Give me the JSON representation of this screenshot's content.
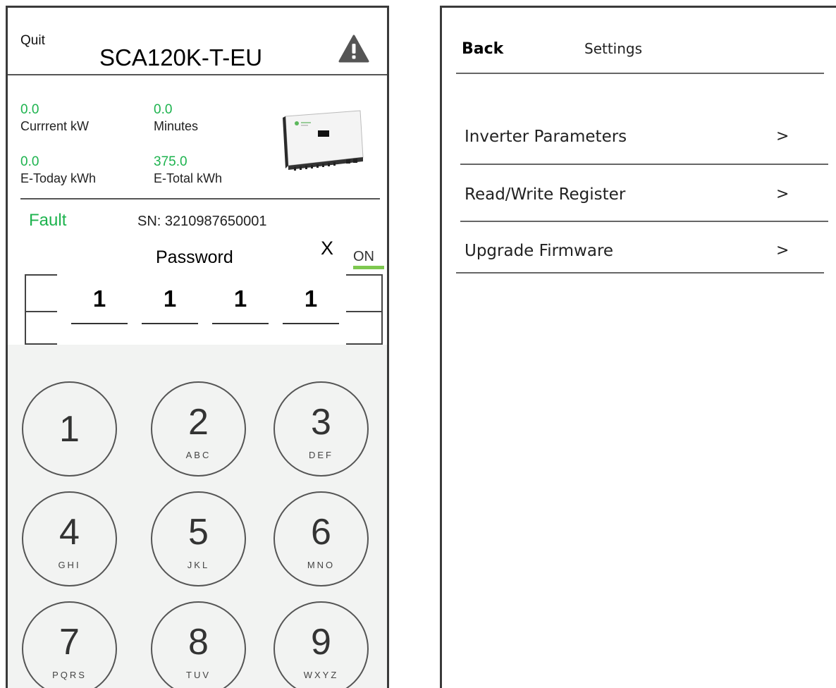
{
  "left": {
    "quit_label": "Quit",
    "device_title": "SCA120K-T-EU",
    "stats": [
      {
        "value": "0.0",
        "label": "Currrent kW"
      },
      {
        "value": "0.0",
        "label": "Minutes"
      },
      {
        "value": "0.0",
        "label": "E-Today kWh"
      },
      {
        "value": "375.0",
        "label": "E-Total kWh"
      }
    ],
    "status_text": "Fault",
    "serial_text": "SN:  3210987650001",
    "tab_edge_text": "ON",
    "password_dialog": {
      "title": "Password",
      "close_label": "X",
      "digits": [
        "1",
        "1",
        "1",
        "1"
      ]
    },
    "keypad": [
      {
        "num": "1",
        "letters": ""
      },
      {
        "num": "2",
        "letters": "ABC"
      },
      {
        "num": "3",
        "letters": "DEF"
      },
      {
        "num": "4",
        "letters": "GHI"
      },
      {
        "num": "5",
        "letters": "JKL"
      },
      {
        "num": "6",
        "letters": "MNO"
      },
      {
        "num": "7",
        "letters": "PQRS"
      },
      {
        "num": "8",
        "letters": "TUV"
      },
      {
        "num": "9",
        "letters": "WXYZ"
      }
    ]
  },
  "right": {
    "back_label": "Back",
    "title": "Settings",
    "menu": [
      {
        "label": "Inverter Parameters",
        "arrow": ">"
      },
      {
        "label": "Read/Write  Register",
        "arrow": ">"
      },
      {
        "label": "Upgrade Firmware",
        "arrow": ">"
      }
    ]
  },
  "colors": {
    "accent_green": "#1db34e",
    "tab_underline": "#7ec850",
    "keypad_bg": "#f2f3f2"
  },
  "icons": {
    "warning": "warning-triangle-icon",
    "inverter": "inverter-device-image"
  }
}
